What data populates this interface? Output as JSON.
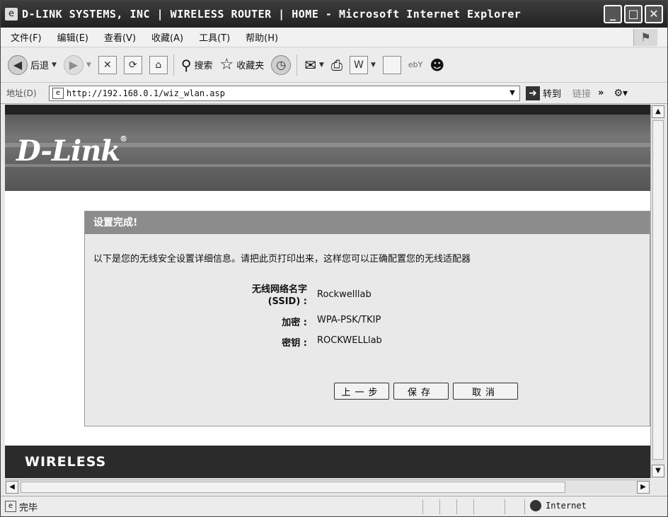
{
  "window": {
    "title": "D-LINK SYSTEMS, INC | WIRELESS ROUTER | HOME - Microsoft Internet Explorer",
    "controls": {
      "minimize": "_",
      "maximize": "□",
      "close": "✕"
    }
  },
  "menubar": {
    "items": [
      {
        "label": "文件(F)"
      },
      {
        "label": "编辑(E)"
      },
      {
        "label": "查看(V)"
      },
      {
        "label": "收藏(A)"
      },
      {
        "label": "工具(T)"
      },
      {
        "label": "帮助(H)"
      }
    ]
  },
  "toolbar": {
    "back_label": "后退",
    "search_label": "搜索",
    "favorites_label": "收藏夹"
  },
  "address": {
    "label": "地址(D)",
    "url": "http://192.168.0.1/wiz_wlan.asp",
    "go_label": "转到",
    "links_label": "链接",
    "more": "»"
  },
  "page": {
    "brand": "D-Link",
    "brand_mark": "®",
    "panel_title": "设置完成!",
    "intro": "以下是您的无线安全设置详细信息。请把此页打印出来，这样您可以正确配置您的无线适配器",
    "fields": [
      {
        "label_line1": "无线网络名字",
        "label_line2": "(SSID) :",
        "value": "Rockwelllab"
      },
      {
        "label": "加密 :",
        "value": "WPA-PSK/TKIP"
      },
      {
        "label": "密钥 :",
        "value": "ROCKWELLlab"
      }
    ],
    "buttons": {
      "prev": "上一步",
      "save": "保存",
      "cancel": "取消"
    },
    "footer_brand": "WIRELESS"
  },
  "status": {
    "text": "完毕",
    "zone": "Internet"
  },
  "colors": {
    "titlebar": "#2e2e2e",
    "panel_header": "#8c8c8c",
    "panel_bg": "#e9e9e9",
    "footer": "#2b2b2b"
  }
}
